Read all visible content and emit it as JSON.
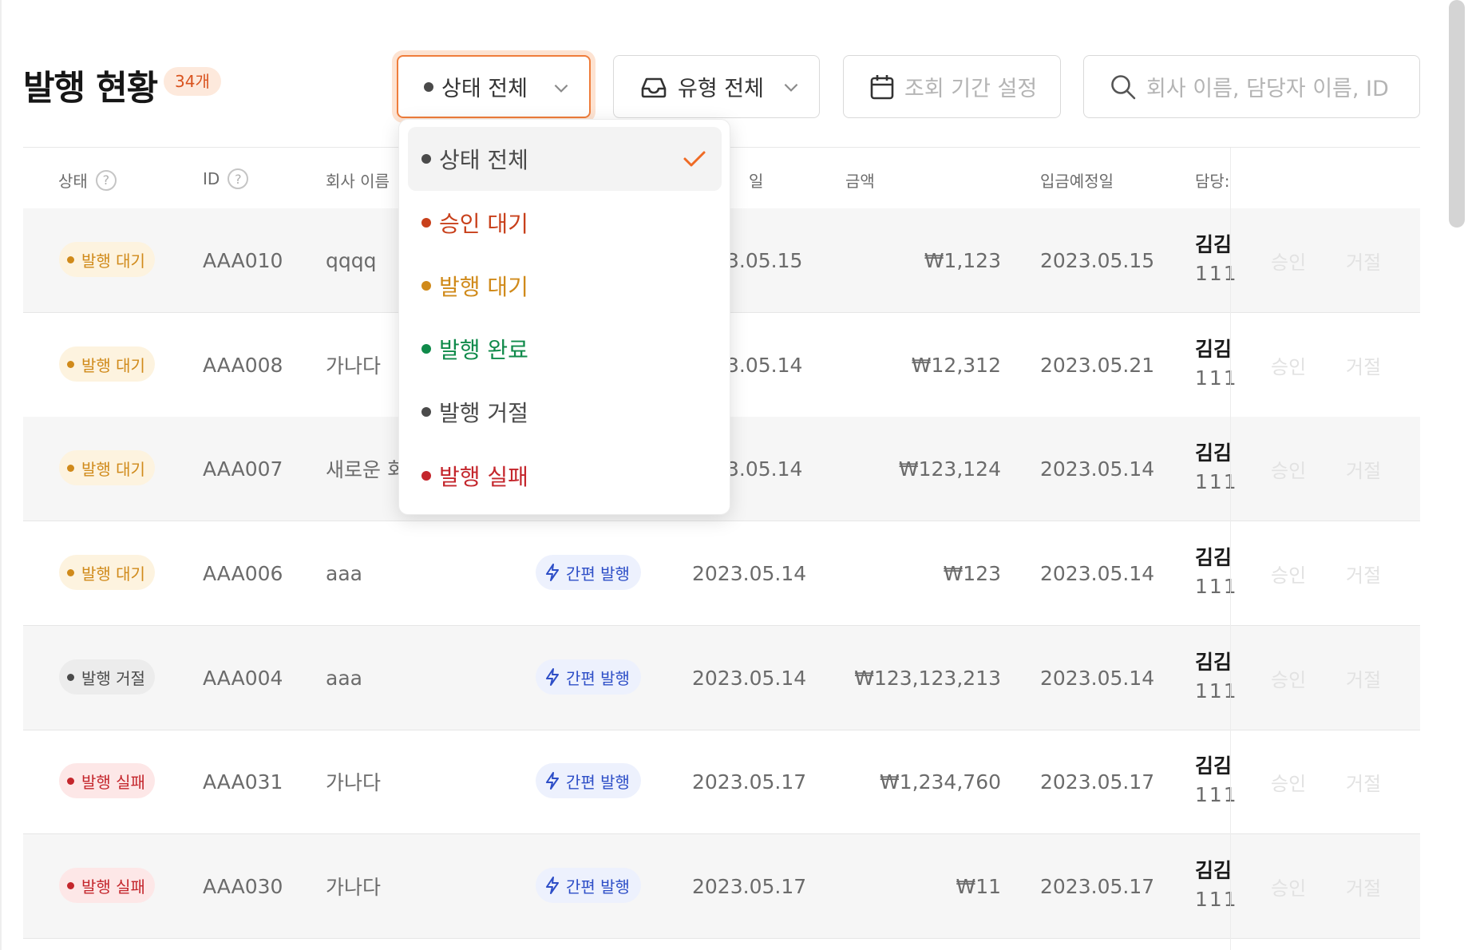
{
  "header": {
    "title": "발행 현황",
    "count": "34개"
  },
  "filters": {
    "status_label": "상태 전체",
    "type_label": "유형 전체",
    "date_label": "조회 기간 설정",
    "search_placeholder": "회사 이름, 담당자 이름,  ID"
  },
  "table": {
    "headers": {
      "status": "상태",
      "id": "ID",
      "company": "회사 이름",
      "issue_date_partial": "일",
      "amount": "금액",
      "due_date": "입금예정일",
      "manager_partial": "담당:"
    },
    "approve_label": "승인",
    "reject_label": "거절",
    "rows": [
      {
        "status": "발행 대기",
        "status_kind": "wait",
        "id": "AAA010",
        "company": "qqqq",
        "type": "",
        "issue_date": "3.05.15",
        "amount": "₩1,123",
        "due_date": "2023.05.15",
        "manager_name": "김김",
        "manager_sub": "111"
      },
      {
        "status": "발행 대기",
        "status_kind": "wait",
        "id": "AAA008",
        "company": "가나다",
        "type": "",
        "issue_date": "3.05.14",
        "amount": "₩12,312",
        "due_date": "2023.05.21",
        "manager_name": "김김",
        "manager_sub": "111"
      },
      {
        "status": "발행 대기",
        "status_kind": "wait",
        "id": "AAA007",
        "company": "새로운 회",
        "type": "",
        "issue_date": "3.05.14",
        "amount": "₩123,124",
        "due_date": "2023.05.14",
        "manager_name": "김김",
        "manager_sub": "111"
      },
      {
        "status": "발행 대기",
        "status_kind": "wait",
        "id": "AAA006",
        "company": "aaa",
        "type": "간편 발행",
        "issue_date": "2023.05.14",
        "amount": "₩123",
        "due_date": "2023.05.14",
        "manager_name": "김김",
        "manager_sub": "111"
      },
      {
        "status": "발행 거절",
        "status_kind": "reject",
        "id": "AAA004",
        "company": "aaa",
        "type": "간편 발행",
        "issue_date": "2023.05.14",
        "amount": "₩123,123,213",
        "due_date": "2023.05.14",
        "manager_name": "김김",
        "manager_sub": "111"
      },
      {
        "status": "발행 실패",
        "status_kind": "fail",
        "id": "AAA031",
        "company": "가나다",
        "type": "간편 발행",
        "issue_date": "2023.05.17",
        "amount": "₩1,234,760",
        "due_date": "2023.05.17",
        "manager_name": "김김",
        "manager_sub": "111"
      },
      {
        "status": "발행 실패",
        "status_kind": "fail",
        "id": "AAA030",
        "company": "가나다",
        "type": "간편 발행",
        "issue_date": "2023.05.17",
        "amount": "₩11",
        "due_date": "2023.05.17",
        "manager_name": "김김",
        "manager_sub": "111"
      }
    ]
  },
  "status_dropdown": {
    "items": [
      {
        "label": "상태 전체",
        "color": "#4a4a4a",
        "selected": true
      },
      {
        "label": "승인 대기",
        "color": "#c8401b",
        "selected": false
      },
      {
        "label": "발행 대기",
        "color": "#d08a1a",
        "selected": false
      },
      {
        "label": "발행 완료",
        "color": "#0f8a4a",
        "selected": false
      },
      {
        "label": "발행 거절",
        "color": "#4a4a4a",
        "selected": false
      },
      {
        "label": "발행 실패",
        "color": "#c4262c",
        "selected": false
      }
    ]
  },
  "colors": {
    "accent": "#ef7d3b",
    "type_tag": "#2d4ec7"
  },
  "icons": {
    "filter_status": "chevron-down-icon",
    "filter_type": "inbox-icon",
    "filter_date": "calendar-icon",
    "filter_search": "search-icon",
    "type_tag": "lightning-icon",
    "selected": "check-icon",
    "header_help": "question-circle-icon"
  }
}
